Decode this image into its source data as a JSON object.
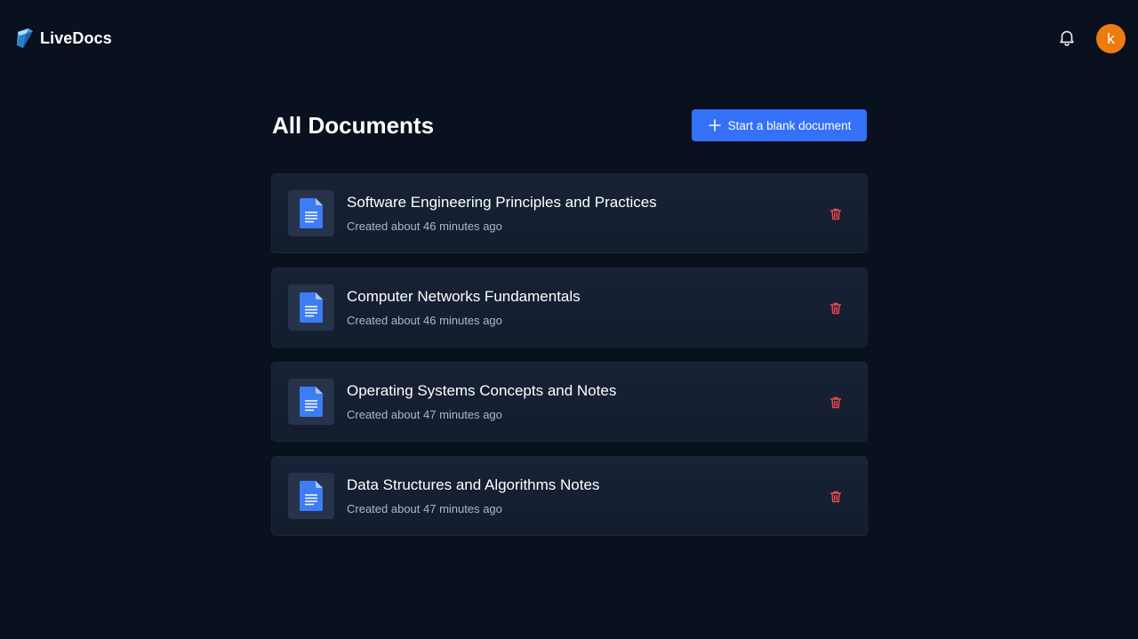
{
  "app": {
    "name": "LiveDocs"
  },
  "header": {
    "avatar_initial": "k"
  },
  "main": {
    "title": "All Documents",
    "new_button_label": "Start a blank document",
    "documents": [
      {
        "title": "Software Engineering Principles and Practices",
        "created": "Created about 46 minutes ago"
      },
      {
        "title": "Computer Networks Fundamentals",
        "created": "Created about 46 minutes ago"
      },
      {
        "title": "Operating Systems Concepts and Notes",
        "created": "Created about 47 minutes ago"
      },
      {
        "title": "Data Structures and Algorithms Notes",
        "created": "Created about 47 minutes ago"
      }
    ]
  },
  "icons": {
    "logo": "livedocs-logo-icon",
    "notifications": "bell-icon",
    "new_document": "plus-icon",
    "document": "document-icon",
    "delete": "trash-icon"
  },
  "colors": {
    "background": "#09111f",
    "card": "#161f31",
    "accent": "#3471f8",
    "avatar": "#ee7a12",
    "delete": "#e5484d",
    "meta_text": "#a9b6d1"
  }
}
